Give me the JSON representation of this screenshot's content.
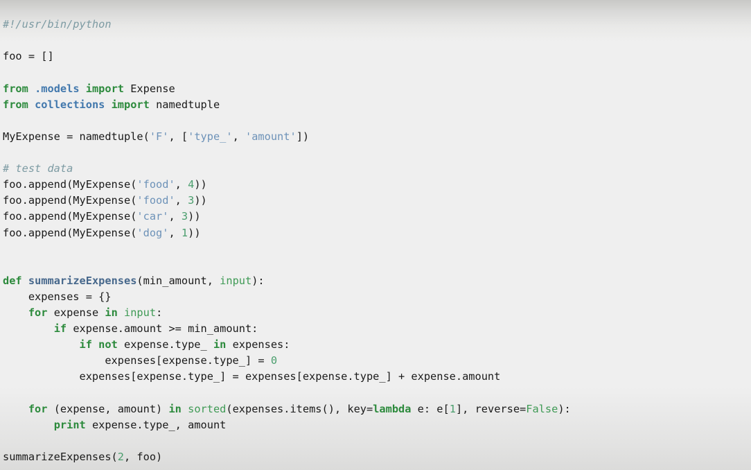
{
  "window": {
    "title": "Python source code snippet",
    "background_color": "#efefef",
    "foreground_color": "#1a1a1a"
  },
  "theme": {
    "comment_color": "#7d9ba3",
    "keyword_color": "#2c8a3c",
    "builtin_color": "#3f9a55",
    "module_color": "#4278ad",
    "function_name_color": "#47688c",
    "string_color": "#6d92b8",
    "number_color": "#4a9e6d",
    "plain_color": "#1a1a1a"
  },
  "code": {
    "language": "python",
    "line_count": 28,
    "plain_text": "#!/usr/bin/python\n\nfoo = []\n\nfrom .models import Expense\nfrom collections import namedtuple\n\nMyExpense = namedtuple('F', ['type_', 'amount'])\n\n# test data\nfoo.append(MyExpense('food', 4))\nfoo.append(MyExpense('food', 3))\nfoo.append(MyExpense('car', 3))\nfoo.append(MyExpense('dog', 1))\n\n\ndef summarizeExpenses(min_amount, input):\n    expenses = {}\n    for expense in input:\n        if expense.amount >= min_amount:\n            if not expense.type_ in expenses:\n                expenses[expense.type_] = 0\n            expenses[expense.type_] = expenses[expense.type_] + expense.amount\n\n    for (expense, amount) in sorted(expenses.items(), key=lambda e: e[1], reverse=False):\n        print expense.type_, amount\n\nsummarizeExpenses(2, foo)",
    "lines": [
      {
        "n": 1,
        "tokens": [
          {
            "t": "#!/usr/bin/python",
            "c": "cm"
          }
        ]
      },
      {
        "n": 2,
        "tokens": []
      },
      {
        "n": 3,
        "tokens": [
          {
            "t": "foo = []",
            "c": "pl"
          }
        ]
      },
      {
        "n": 4,
        "tokens": []
      },
      {
        "n": 5,
        "tokens": [
          {
            "t": "from",
            "c": "kw"
          },
          {
            "t": " ",
            "c": "pl"
          },
          {
            "t": ".models",
            "c": "mod"
          },
          {
            "t": " ",
            "c": "pl"
          },
          {
            "t": "import",
            "c": "kw"
          },
          {
            "t": " Expense",
            "c": "pl"
          }
        ]
      },
      {
        "n": 6,
        "tokens": [
          {
            "t": "from",
            "c": "kw"
          },
          {
            "t": " ",
            "c": "pl"
          },
          {
            "t": "collections",
            "c": "mod"
          },
          {
            "t": " ",
            "c": "pl"
          },
          {
            "t": "import",
            "c": "kw"
          },
          {
            "t": " namedtuple",
            "c": "pl"
          }
        ]
      },
      {
        "n": 7,
        "tokens": []
      },
      {
        "n": 8,
        "tokens": [
          {
            "t": "MyExpense = namedtuple(",
            "c": "pl"
          },
          {
            "t": "'F'",
            "c": "st"
          },
          {
            "t": ", [",
            "c": "pl"
          },
          {
            "t": "'type_'",
            "c": "st"
          },
          {
            "t": ", ",
            "c": "pl"
          },
          {
            "t": "'amount'",
            "c": "st"
          },
          {
            "t": "])",
            "c": "pl"
          }
        ]
      },
      {
        "n": 9,
        "tokens": []
      },
      {
        "n": 10,
        "tokens": [
          {
            "t": "# test data",
            "c": "cm"
          }
        ]
      },
      {
        "n": 11,
        "tokens": [
          {
            "t": "foo.append(MyExpense(",
            "c": "pl"
          },
          {
            "t": "'food'",
            "c": "st"
          },
          {
            "t": ", ",
            "c": "pl"
          },
          {
            "t": "4",
            "c": "nu"
          },
          {
            "t": "))",
            "c": "pl"
          }
        ]
      },
      {
        "n": 12,
        "tokens": [
          {
            "t": "foo.append(MyExpense(",
            "c": "pl"
          },
          {
            "t": "'food'",
            "c": "st"
          },
          {
            "t": ", ",
            "c": "pl"
          },
          {
            "t": "3",
            "c": "nu"
          },
          {
            "t": "))",
            "c": "pl"
          }
        ]
      },
      {
        "n": 13,
        "tokens": [
          {
            "t": "foo.append(MyExpense(",
            "c": "pl"
          },
          {
            "t": "'car'",
            "c": "st"
          },
          {
            "t": ", ",
            "c": "pl"
          },
          {
            "t": "3",
            "c": "nu"
          },
          {
            "t": "))",
            "c": "pl"
          }
        ]
      },
      {
        "n": 14,
        "tokens": [
          {
            "t": "foo.append(MyExpense(",
            "c": "pl"
          },
          {
            "t": "'dog'",
            "c": "st"
          },
          {
            "t": ", ",
            "c": "pl"
          },
          {
            "t": "1",
            "c": "nu"
          },
          {
            "t": "))",
            "c": "pl"
          }
        ]
      },
      {
        "n": 15,
        "tokens": []
      },
      {
        "n": 16,
        "tokens": []
      },
      {
        "n": 17,
        "tokens": [
          {
            "t": "def",
            "c": "kw"
          },
          {
            "t": " ",
            "c": "pl"
          },
          {
            "t": "summarizeExpenses",
            "c": "fn"
          },
          {
            "t": "(min_amount, ",
            "c": "pl"
          },
          {
            "t": "input",
            "c": "kwn"
          },
          {
            "t": "):",
            "c": "pl"
          }
        ]
      },
      {
        "n": 18,
        "tokens": [
          {
            "t": "    expenses = {}",
            "c": "pl"
          }
        ]
      },
      {
        "n": 19,
        "tokens": [
          {
            "t": "    ",
            "c": "pl"
          },
          {
            "t": "for",
            "c": "kw"
          },
          {
            "t": " expense ",
            "c": "pl"
          },
          {
            "t": "in",
            "c": "kw"
          },
          {
            "t": " ",
            "c": "pl"
          },
          {
            "t": "input",
            "c": "kwn"
          },
          {
            "t": ":",
            "c": "pl"
          }
        ]
      },
      {
        "n": 20,
        "tokens": [
          {
            "t": "        ",
            "c": "pl"
          },
          {
            "t": "if",
            "c": "kw"
          },
          {
            "t": " expense.amount >= min_amount:",
            "c": "pl"
          }
        ]
      },
      {
        "n": 21,
        "tokens": [
          {
            "t": "            ",
            "c": "pl"
          },
          {
            "t": "if",
            "c": "kw"
          },
          {
            "t": " ",
            "c": "pl"
          },
          {
            "t": "not",
            "c": "kw"
          },
          {
            "t": " expense.type_ ",
            "c": "pl"
          },
          {
            "t": "in",
            "c": "kw"
          },
          {
            "t": " expenses:",
            "c": "pl"
          }
        ]
      },
      {
        "n": 22,
        "tokens": [
          {
            "t": "                expenses[expense.type_] = ",
            "c": "pl"
          },
          {
            "t": "0",
            "c": "nu"
          }
        ]
      },
      {
        "n": 23,
        "tokens": [
          {
            "t": "            expenses[expense.type_] = expenses[expense.type_] + expense.amount",
            "c": "pl"
          }
        ]
      },
      {
        "n": 24,
        "tokens": []
      },
      {
        "n": 25,
        "tokens": [
          {
            "t": "    ",
            "c": "pl"
          },
          {
            "t": "for",
            "c": "kw"
          },
          {
            "t": " (expense, amount) ",
            "c": "pl"
          },
          {
            "t": "in",
            "c": "kw"
          },
          {
            "t": " ",
            "c": "pl"
          },
          {
            "t": "sorted",
            "c": "bi"
          },
          {
            "t": "(expenses.items(), key=",
            "c": "pl"
          },
          {
            "t": "lambda",
            "c": "kw"
          },
          {
            "t": " e: e[",
            "c": "pl"
          },
          {
            "t": "1",
            "c": "nu"
          },
          {
            "t": "], reverse=",
            "c": "pl"
          },
          {
            "t": "False",
            "c": "kwn"
          },
          {
            "t": "):",
            "c": "pl"
          }
        ]
      },
      {
        "n": 26,
        "tokens": [
          {
            "t": "        ",
            "c": "pl"
          },
          {
            "t": "print",
            "c": "kw"
          },
          {
            "t": " expense.type_, amount",
            "c": "pl"
          }
        ]
      },
      {
        "n": 27,
        "tokens": []
      },
      {
        "n": 28,
        "tokens": [
          {
            "t": "summarizeExpenses(",
            "c": "pl"
          },
          {
            "t": "2",
            "c": "nu"
          },
          {
            "t": ", foo)",
            "c": "pl"
          }
        ]
      }
    ]
  }
}
